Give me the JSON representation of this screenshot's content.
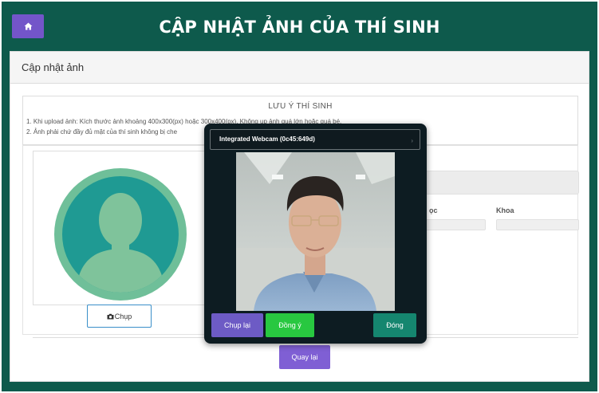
{
  "header": {
    "title": "CẬP NHẬT ẢNH CỦA THÍ SINH",
    "home_icon": "home-icon"
  },
  "panel": {
    "title": "Cập nhật ảnh"
  },
  "notice": {
    "title": "LƯU Ý THÍ SINH",
    "line1": "1. Khi upload ảnh: Kích thước ảnh khoảng 400x300(px) hoặc 300x400(px). Không up ảnh quá lớn hoặc quá bé.",
    "line2": "2. Ảnh phải chứ đầy đủ mặt của thí sinh không bị che"
  },
  "info": {
    "label_lop": "ọc",
    "label_khoa": "Khoa"
  },
  "buttons": {
    "chup": "Chụp",
    "back": "Quay lại"
  },
  "camera": {
    "device": "Integrated Webcam (0c45:649d)",
    "retake": "Chụp lại",
    "agree": "Đồng ý",
    "close": "Đóng"
  },
  "colors": {
    "header_bg": "#0e5a4c",
    "primary_purple": "#7355c9",
    "agree_green": "#28c840",
    "close_teal": "#15866f",
    "avatar_ring": "#6fbf99",
    "avatar_fill": "#1f9a93"
  }
}
